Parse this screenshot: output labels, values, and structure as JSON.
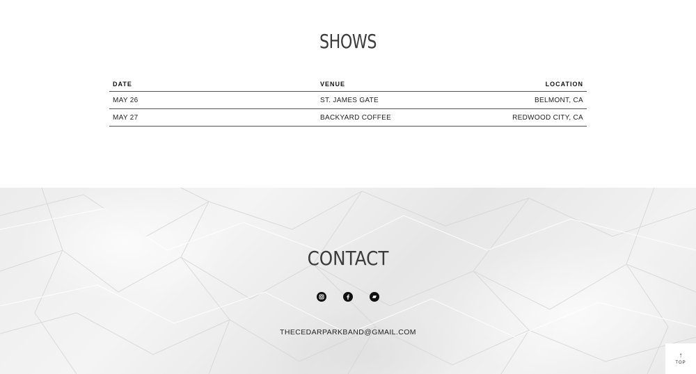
{
  "shows": {
    "title": "SHOWS",
    "columns": {
      "date": "DATE",
      "venue": "VENUE",
      "location": "LOCATION"
    },
    "rows": [
      {
        "date": "MAY 26",
        "venue": "ST. JAMES GATE",
        "location": "BELMONT, CA"
      },
      {
        "date": "MAY 27",
        "venue": "BACKYARD COFFEE",
        "location": "REDWOOD CITY, CA"
      }
    ]
  },
  "contact": {
    "title": "CONTACT",
    "social": [
      "instagram-icon",
      "facebook-icon",
      "bandcamp-icon"
    ],
    "email": "THECEDARPARKBAND@GMAIL.COM"
  },
  "back_to_top": {
    "arrow": "↑",
    "label": "TOP"
  }
}
